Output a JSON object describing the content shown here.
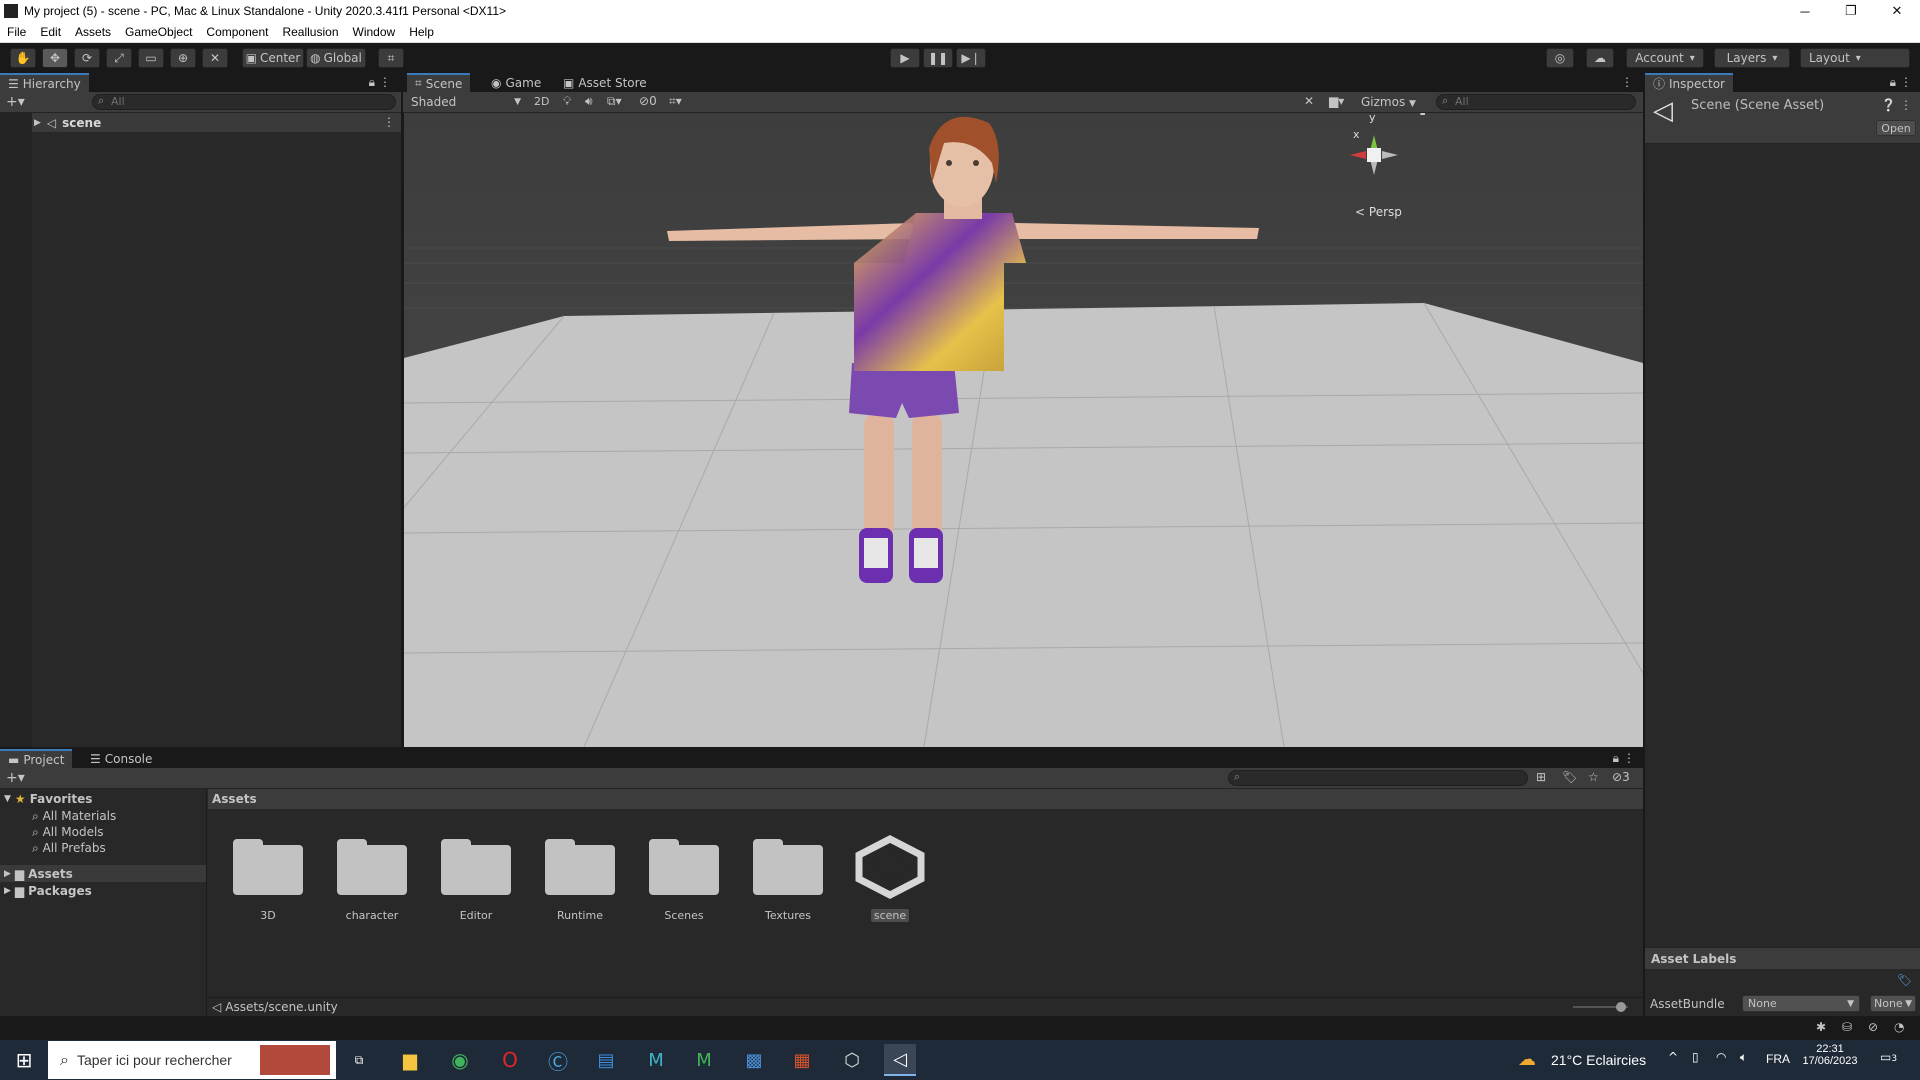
{
  "window": {
    "title": "My project (5) - scene - PC, Mac & Linux Standalone - Unity 2020.3.41f1 Personal <DX11>",
    "controls": [
      "─",
      "❐",
      "✕"
    ]
  },
  "menu": [
    "File",
    "Edit",
    "Assets",
    "GameObject",
    "Component",
    "Reallusion",
    "Window",
    "Help"
  ],
  "toolbar": {
    "pivot_label": "Center",
    "space_label": "Global",
    "account_label": "Account",
    "layers_label": "Layers",
    "layout_label": "Layout"
  },
  "hierarchy": {
    "tab": "Hierarchy",
    "search_placeholder": "All",
    "items": [
      {
        "label": "scene"
      }
    ]
  },
  "scene_panel": {
    "tabs": [
      "Scene",
      "Game",
      "Asset Store"
    ],
    "shading": "Shaded",
    "mode_2d": "2D",
    "hidden_count": "0",
    "gizmos": "Gizmos",
    "search_placeholder": "All",
    "gizmo": {
      "x": "x",
      "y": "y",
      "projection": "Persp"
    }
  },
  "inspector": {
    "tab": "Inspector",
    "title": "Scene (Scene Asset)",
    "open_button": "Open",
    "asset_labels_title": "Asset Labels",
    "assetbundle_label": "AssetBundle",
    "assetbundle_value": "None",
    "variant_value": "None"
  },
  "project": {
    "tabs": [
      "Project",
      "Console"
    ],
    "hidden_count": "3",
    "favorites_title": "Favorites",
    "favorites": [
      "All Materials",
      "All Models",
      "All Prefabs"
    ],
    "roots": [
      "Assets",
      "Packages"
    ],
    "breadcrumb": "Assets",
    "assets": [
      "3D",
      "character",
      "Editor",
      "Runtime",
      "Scenes",
      "Textures",
      "scene"
    ],
    "selected_path": "Assets/scene.unity"
  },
  "taskbar": {
    "search_placeholder": "Taper ici pour rechercher",
    "weather": "21°C  Eclaircies",
    "language": "FRA",
    "time": "22:31",
    "date": "17/06/2023",
    "notification_count": "3"
  },
  "colors": {
    "accent": "#3a79bb",
    "panel": "#282828",
    "toolbar": "#3c3c3c"
  }
}
